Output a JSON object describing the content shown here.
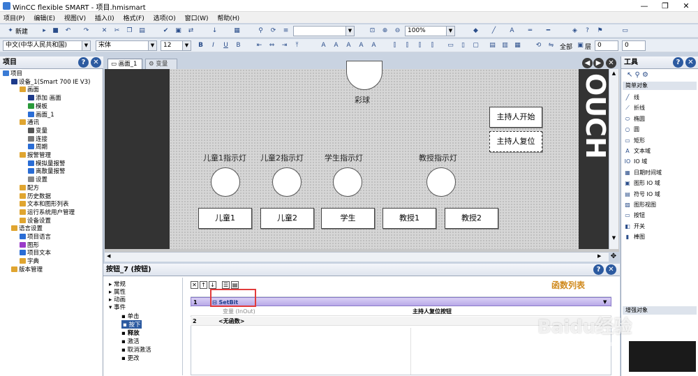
{
  "window": {
    "title": "WinCC flexible SMART - 项目.hmismart"
  },
  "menu": [
    "项目(P)",
    "编辑(E)",
    "视图(V)",
    "插入(I)",
    "格式(F)",
    "选项(O)",
    "窗口(W)",
    "帮助(H)"
  ],
  "toolbar": {
    "new_label": "新建",
    "zoom_value": "100%",
    "language": "中文(中华人民共和国)",
    "font": "宋体",
    "font_size": "12",
    "all_label": "全部",
    "layer_label": "层",
    "spin1": "0",
    "spin2": "0"
  },
  "project_panel": {
    "title": "项目",
    "tree": [
      {
        "label": "项目",
        "depth": 0,
        "icon": "project-icon"
      },
      {
        "label": "设备_1(Smart 700 IE V3)",
        "depth": 1,
        "icon": "device-icon"
      },
      {
        "label": "画面",
        "depth": 2,
        "icon": "folder-icon"
      },
      {
        "label": "添加 画面",
        "depth": 3,
        "icon": "add-screen-icon"
      },
      {
        "label": "模板",
        "depth": 3,
        "icon": "template-icon"
      },
      {
        "label": "画面_1",
        "depth": 3,
        "icon": "screen-icon"
      },
      {
        "label": "通讯",
        "depth": 2,
        "icon": "folder-icon"
      },
      {
        "label": "变量",
        "depth": 3,
        "icon": "tag-icon"
      },
      {
        "label": "连接",
        "depth": 3,
        "icon": "connection-icon"
      },
      {
        "label": "周期",
        "depth": 3,
        "icon": "cycle-icon"
      },
      {
        "label": "报警管理",
        "depth": 2,
        "icon": "folder-icon"
      },
      {
        "label": "模拟量报警",
        "depth": 3,
        "icon": "alarm-icon"
      },
      {
        "label": "离散量报警",
        "depth": 3,
        "icon": "alarm-icon"
      },
      {
        "label": "设置",
        "depth": 3,
        "icon": "settings-icon"
      },
      {
        "label": "配方",
        "depth": 2,
        "icon": "folder-icon"
      },
      {
        "label": "历史数据",
        "depth": 2,
        "icon": "folder-icon"
      },
      {
        "label": "文本和图形列表",
        "depth": 2,
        "icon": "folder-icon"
      },
      {
        "label": "运行系统用户管理",
        "depth": 2,
        "icon": "folder-icon"
      },
      {
        "label": "设备设置",
        "depth": 2,
        "icon": "folder-icon"
      },
      {
        "label": "语言设置",
        "depth": 1,
        "icon": "folder-icon"
      },
      {
        "label": "项目语言",
        "depth": 2,
        "icon": "language-icon"
      },
      {
        "label": "图形",
        "depth": 2,
        "icon": "graphics-icon"
      },
      {
        "label": "项目文本",
        "depth": 2,
        "icon": "text-icon"
      },
      {
        "label": "字典",
        "depth": 2,
        "icon": "folder-icon"
      },
      {
        "label": "版本管理",
        "depth": 1,
        "icon": "folder-icon"
      }
    ]
  },
  "editor": {
    "tabs": [
      "画面_1",
      "变量"
    ],
    "screen": {
      "ball_label": "彩球",
      "host_start": "主持人开始",
      "host_reset": "主持人复位",
      "lamps": [
        "儿童1指示灯",
        "儿童2指示灯",
        "学生指示灯",
        "教授指示灯"
      ],
      "buttons": [
        "儿童1",
        "儿童2",
        "学生",
        "教授1",
        "教授2"
      ],
      "side_text": "OUCH"
    }
  },
  "properties": {
    "title": "按钮_7 (按钮)",
    "categories": [
      "常规",
      "属性",
      "动画",
      "事件"
    ],
    "events": [
      "单击",
      "按下",
      "释放",
      "激活",
      "取消激活",
      "更改"
    ],
    "selected_event": "按下",
    "function_list_title": "函数列表",
    "rows": [
      {
        "num": "1",
        "func": "SetBit",
        "param_label": "变量 (InOut)",
        "param_value": "主持人复位按钮"
      },
      {
        "num": "2",
        "func": "<无函数>"
      }
    ]
  },
  "toolbox": {
    "title": "工具",
    "section": "简单对象",
    "items": [
      "线",
      "折线",
      "椭圆",
      "圆",
      "矩形",
      "文本域",
      "IO 域",
      "日期时间域",
      "图形 IO 域",
      "符号 IO 域",
      "图形视图",
      "按钮",
      "开关",
      "棒图"
    ],
    "bottom_section": "增强对象"
  },
  "watermark": {
    "text": "Baidu经验",
    "sub": "jingyan.baidu.com"
  }
}
